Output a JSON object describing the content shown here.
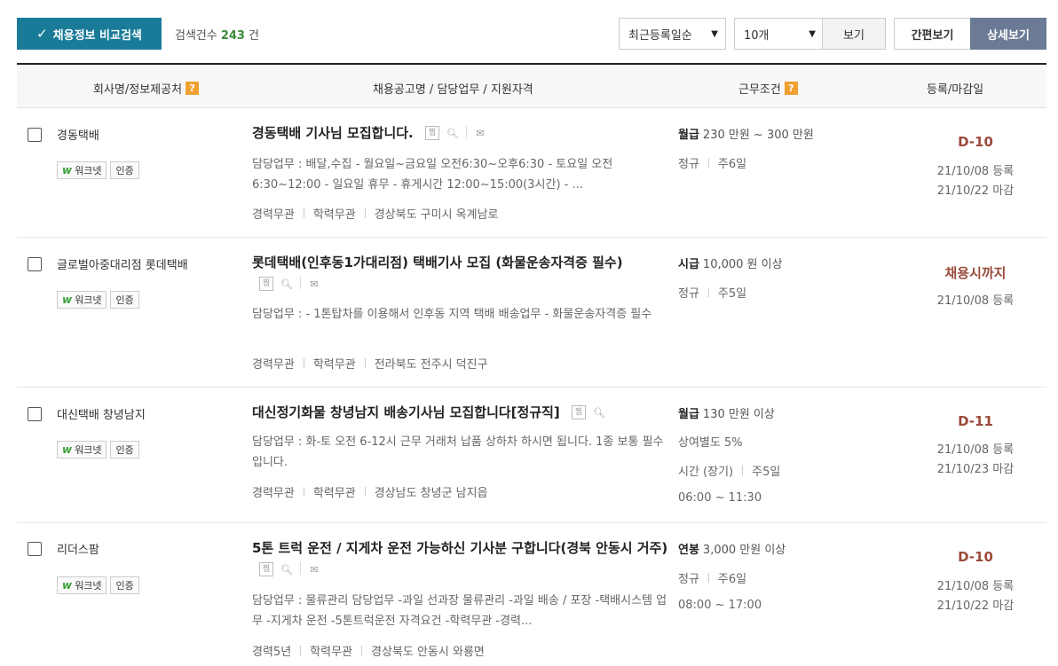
{
  "toolbar": {
    "compare_label": "채용정보 비교검색",
    "count_label": "검색건수",
    "count_value": "243",
    "count_unit": "건",
    "sort_value": "최근등록일순",
    "per_page_value": "10개",
    "view_label": "보기",
    "simple_view_label": "간편보기",
    "detail_view_label": "상세보기"
  },
  "header": {
    "company": "회사명/정보제공처",
    "title": "채용공고명 / 담당업무 / 지원자격",
    "condition": "근무조건",
    "date": "등록/마감일",
    "help_mark": "?"
  },
  "badges": {
    "worknet": "워크넷",
    "certified": "인증",
    "worknet_logo": "w"
  },
  "icons": {
    "scrap": "찜"
  },
  "rows": [
    {
      "company": "경동택배",
      "title": "경동택배 기사님 모집합니다.",
      "duty": "담당업무 : 배달,수집 - 월요일~금요일 오전6:30~오후6:30 - 토요일 오전 6:30~12:00 - 일요일 휴무 - 휴게시간 12:00~15:00(3시간) - ...",
      "career": "경력무관",
      "education": "학력무관",
      "location": "경상북도 구미시 옥계남로",
      "pay_type": "월급",
      "pay": "230 만원 ~ 300 만원",
      "employment": "정규",
      "week": "주6일",
      "dday": "D-10",
      "registered": "21/10/08 등록",
      "deadline": "21/10/22 마감"
    },
    {
      "company": "글로벌아중대리점 롯데택배",
      "title": "롯데택배(인후동1가대리점) 택배기사 모집 (화물운송자격증 필수)",
      "duty": "담당업무 : - 1톤탑차를 이용해서 인후동 지역 택배 배송업무 - 화물운송자격증 필수",
      "career": "경력무관",
      "education": "학력무관",
      "location": "전라북도 전주시 덕진구",
      "pay_type": "시급",
      "pay": "10,000 원 이상",
      "employment": "정규",
      "week": "주5일",
      "dday": "채용시까지",
      "registered": "21/10/08 등록"
    },
    {
      "company": "대신택배 창녕남지",
      "title": "대신정기화물 창녕남지 배송기사님 모집합니다[정규직]",
      "duty": "담당업무 : 화-토 오전 6-12시 근무 거래처 납품 상하차 하시면 됩니다. 1종 보통 필수입니다.",
      "career": "경력무관",
      "education": "학력무관",
      "location": "경상남도 창녕군 남지읍",
      "pay_type": "월급",
      "pay": "130 만원 이상",
      "bonus": "상여별도 5%",
      "employment": "시간 (장기)",
      "week": "주5일",
      "hours": "06:00 ~ 11:30",
      "dday": "D-11",
      "registered": "21/10/08 등록",
      "deadline": "21/10/23 마감"
    },
    {
      "company": "리더스팜",
      "title": "5톤 트럭 운전 / 지게차 운전 가능하신 기사분 구합니다(경북 안동시 거주)",
      "duty": "담당업무 : 물류관리 담당업무 -과일 선과장 물류관리 -과일 배송 / 포장 -택배시스템 업무 -지게차 운전 -5톤트럭운전 자격요건 -학력무관 -경력...",
      "career": "경력5년",
      "education": "학력무관",
      "location": "경상북도 안동시 와룡면",
      "pay_type": "연봉",
      "pay": "3,000 만원 이상",
      "employment": "정규",
      "week": "주6일",
      "hours": "08:00 ~ 17:00",
      "dday": "D-10",
      "registered": "21/10/08 등록",
      "deadline": "21/10/22 마감"
    }
  ]
}
